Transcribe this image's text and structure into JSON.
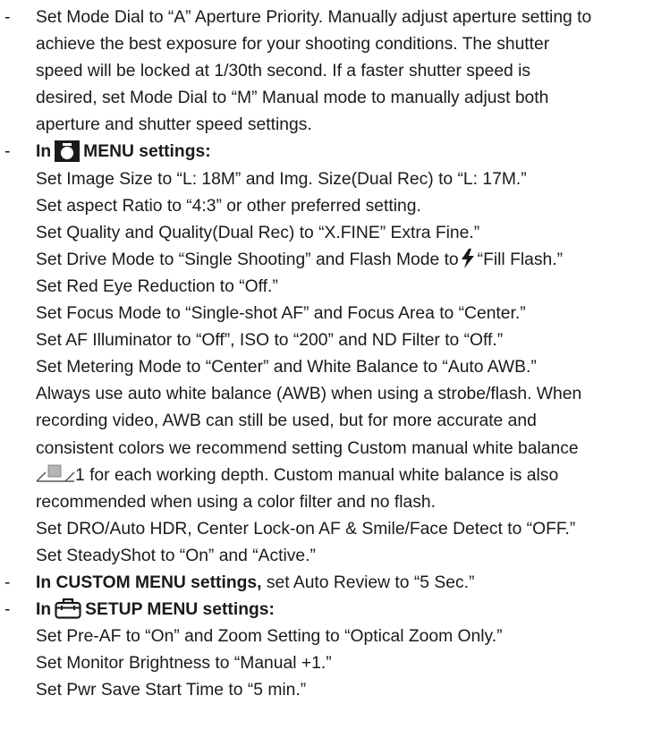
{
  "items": [
    {
      "dash": "-",
      "lines": [
        "Set Mode Dial to “A” Aperture Priority. Manually adjust aperture setting to",
        "achieve the best exposure for your shooting conditions. The shutter",
        "speed will be locked at 1/30th second. If a faster shutter speed is",
        "desired, set Mode Dial to “M” Manual mode to manually adjust both",
        "aperture and shutter speed settings."
      ]
    },
    {
      "dash": "-",
      "heading_pre": "In",
      "heading_icon": "camera-icon",
      "heading_post": "MENU settings:",
      "lines": [
        "Set Image Size to “L: 18M” and Img. Size(Dual Rec) to “L: 17M.”",
        "Set aspect Ratio to “4:3” or other preferred setting.",
        "Set Quality and Quality(Dual Rec) to “X.FINE” Extra Fine.”"
      ],
      "flash_pre": "Set Drive Mode to “Single Shooting” and Flash Mode to",
      "flash_icon": "flash-icon",
      "flash_post": "“Fill Flash.”",
      "lines2": [
        "Set Red Eye Reduction to “Off.”",
        "Set Focus Mode to “Single-shot AF” and Focus Area to “Center.”",
        "Set AF Illuminator to “Off”, ISO to “200” and ND Filter to “Off.”",
        "Set Metering Mode to “Center” and White Balance to “Auto AWB.”",
        "Always use auto white balance (AWB) when using a strobe/flash. When",
        "recording video, AWB can still be used, but for more accurate and",
        "consistent colors we recommend setting Custom manual white balance"
      ],
      "wb_icon": "custom-white-balance-icon",
      "wb_post": "1 for each working depth. Custom manual white balance is also",
      "lines3": [
        "recommended when using a color filter and no flash.",
        "Set DRO/Auto HDR, Center Lock-on AF & Smile/Face Detect to “OFF.”",
        "Set SteadyShot to “On” and “Active.”"
      ]
    },
    {
      "dash": "-",
      "bold": "In CUSTOM MENU settings,",
      "rest": " set Auto Review to “5 Sec.”"
    },
    {
      "dash": "-",
      "heading_pre": "In",
      "heading_icon": "toolbox-icon",
      "heading_post": "SETUP MENU settings:",
      "lines": [
        "Set Pre-AF to “On” and Zoom Setting to “Optical Zoom Only.”",
        "Set Monitor Brightness to “Manual +1.”",
        "Set Pwr Save Start Time to “5 min.”"
      ]
    }
  ]
}
